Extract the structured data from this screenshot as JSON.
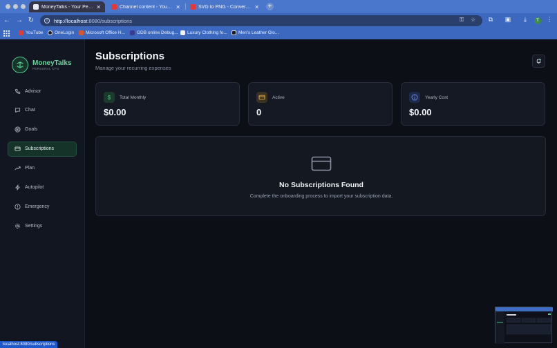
{
  "browser": {
    "tabs": [
      {
        "title": "MoneyTalks - Your Personal CFO",
        "active": true,
        "favicon_color": "#e8ecf2"
      },
      {
        "title": "Channel content - YouTube Studio",
        "active": false,
        "favicon_color": "#e53935"
      },
      {
        "title": "SVG to PNG - Convert SVG to PNG",
        "active": false,
        "favicon_color": "#e53935"
      }
    ],
    "new_tab_label": "+",
    "url_host": "http://localhost",
    "url_rest": ":8080/subscriptions",
    "profile_initial": "T",
    "bookmarks": [
      {
        "label": "YouTube",
        "icon_color": "#e53935"
      },
      {
        "label": "OneLogin",
        "icon_color": "#1c1c1c"
      },
      {
        "label": "Microsoft Office H...",
        "icon_color": "#d9552c"
      },
      {
        "label": "GDB online Debug...",
        "icon_color": "#3b3b8f"
      },
      {
        "label": "Luxury Clothing fo...",
        "icon_color": "#f2f2f2"
      },
      {
        "label": "Men's Leather Glo...",
        "icon_color": "#1c1c1c"
      }
    ],
    "status_url": "localhost:8080/subscriptions"
  },
  "sidebar": {
    "brand_name": "MoneyTalks",
    "brand_sub": "PERSONAL CFO",
    "items": [
      {
        "label": "Advisor",
        "icon": "phone-icon",
        "active": false
      },
      {
        "label": "Chat",
        "icon": "chat-icon",
        "active": false
      },
      {
        "label": "Goals",
        "icon": "target-icon",
        "active": false
      },
      {
        "label": "Subscriptions",
        "icon": "credit-card-icon",
        "active": true
      },
      {
        "label": "Plan",
        "icon": "trending-up-icon",
        "active": false
      },
      {
        "label": "Autopilot",
        "icon": "lightning-icon",
        "active": false
      },
      {
        "label": "Emergency",
        "icon": "alert-circle-icon",
        "active": false
      },
      {
        "label": "Settings",
        "icon": "gear-icon",
        "active": false
      }
    ]
  },
  "main": {
    "title": "Subscriptions",
    "subtitle": "Manage your recurring expenses",
    "cards": [
      {
        "label": "Total Monthly",
        "value": "$0.00",
        "icon": "dollar-icon",
        "accent": "#53c48a"
      },
      {
        "label": "Active",
        "value": "0",
        "icon": "credit-card-icon",
        "accent": "#e0b04a"
      },
      {
        "label": "Yearly Cost",
        "value": "$0.00",
        "icon": "info-icon",
        "accent": "#6b8ff0"
      }
    ],
    "empty_title": "No Subscriptions Found",
    "empty_subtitle": "Complete the onboarding process to import your subscription data."
  },
  "colors": {
    "accent_green": "#53c48a",
    "background": "#0c0f16",
    "card_bg": "#141923",
    "chrome_blue": "#3f6cc4"
  }
}
